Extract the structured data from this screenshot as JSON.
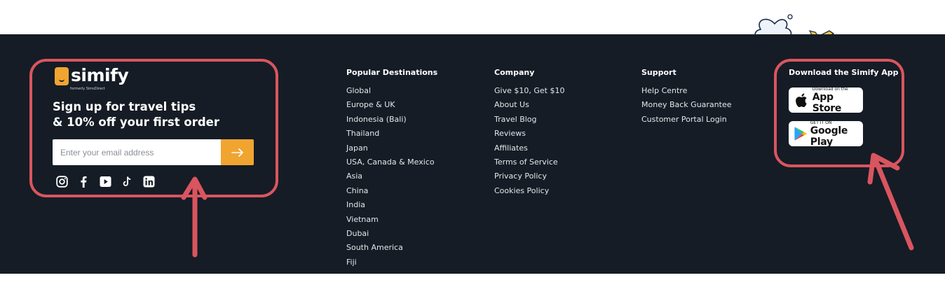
{
  "brand": {
    "name": "simify",
    "formerly": "formerly SimsDirect",
    "tagline_line1": "Sign up for travel tips",
    "tagline_line2": "& 10% off your first order"
  },
  "signup": {
    "placeholder": "Enter your email address",
    "submit_icon": "arrow-right-icon"
  },
  "social": [
    "instagram-icon",
    "facebook-icon",
    "youtube-icon",
    "tiktok-icon",
    "linkedin-icon"
  ],
  "columns": {
    "destinations": {
      "heading": "Popular Destinations",
      "links": [
        "Global",
        "Europe & UK",
        "Indonesia (Bali)",
        "Thailand",
        "Japan",
        "USA, Canada & Mexico",
        "Asia",
        "China",
        "India",
        "Vietnam",
        "Dubai",
        "South America",
        "Fiji"
      ]
    },
    "company": {
      "heading": "Company",
      "links": [
        "Give $10, Get $10",
        "About Us",
        "Travel Blog",
        "Reviews",
        "Affiliates",
        "Terms of Service",
        "Privacy Policy",
        "Cookies Policy"
      ]
    },
    "support": {
      "heading": "Support",
      "links": [
        "Help Centre",
        "Money Back Guarantee",
        "Customer Portal Login"
      ]
    }
  },
  "app": {
    "heading": "Download the Simify App",
    "app_store_small": "Download on the",
    "app_store_big": "App Store",
    "google_small": "GET IT ON",
    "google_big": "Google Play"
  },
  "colors": {
    "footer_bg": "#151c25",
    "accent": "#f0a531",
    "annotation": "#d9555f"
  }
}
